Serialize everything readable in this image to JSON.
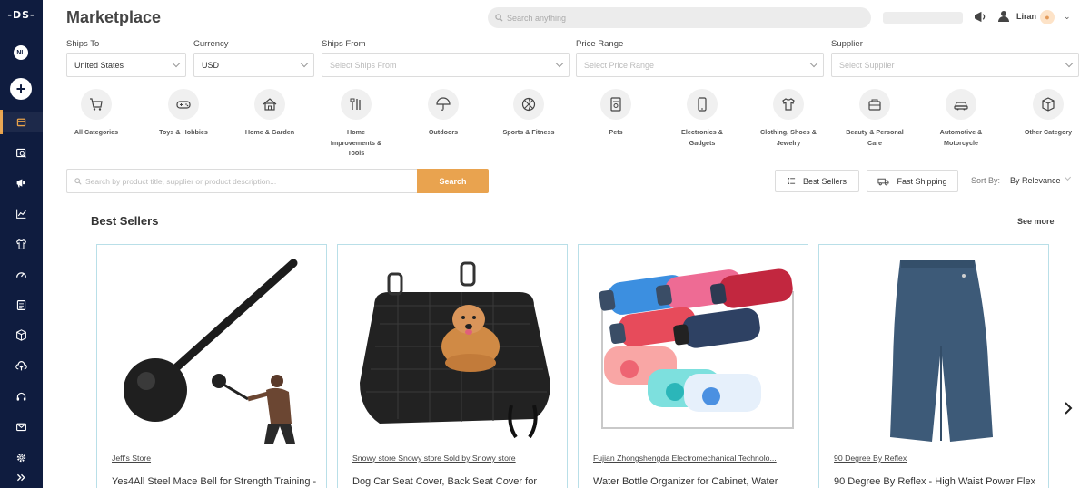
{
  "sidebar": {
    "logo": "-DS-",
    "avatar_initials": "NL",
    "add_label": "+",
    "items": [
      {
        "name": "marketplace",
        "icon": "store-icon"
      },
      {
        "name": "search-products",
        "icon": "product-search-icon"
      },
      {
        "name": "campaigns",
        "icon": "megaphone-icon"
      },
      {
        "name": "analytics",
        "icon": "chart-icon"
      },
      {
        "name": "apparel",
        "icon": "shirt-icon"
      },
      {
        "name": "dashboard",
        "icon": "gauge-icon"
      },
      {
        "name": "orders",
        "icon": "document-icon"
      },
      {
        "name": "products",
        "icon": "box-icon"
      },
      {
        "name": "upload",
        "icon": "cloud-upload-icon"
      },
      {
        "name": "support",
        "icon": "headset-icon"
      },
      {
        "name": "messages",
        "icon": "mail-icon"
      },
      {
        "name": "settings",
        "icon": "gear-icon"
      },
      {
        "name": "expand",
        "icon": "double-chevron-icon"
      }
    ]
  },
  "header": {
    "title": "Marketplace",
    "search_placeholder": "Search anything",
    "user_name": "Liran"
  },
  "filters": {
    "ships_to": {
      "label": "Ships To",
      "value": "United States"
    },
    "currency": {
      "label": "Currency",
      "value": "USD"
    },
    "ships_from": {
      "label": "Ships From",
      "placeholder": "Select Ships From"
    },
    "price_range": {
      "label": "Price Range",
      "placeholder": "Select Price Range"
    },
    "supplier": {
      "label": "Supplier",
      "placeholder": "Select Supplier"
    }
  },
  "categories": [
    {
      "label": "All Categories",
      "icon": "cart-icon"
    },
    {
      "label": "Toys & Hobbies",
      "icon": "gamepad-icon"
    },
    {
      "label": "Home & Garden",
      "icon": "house-icon"
    },
    {
      "label": "Home Improvements & Tools",
      "icon": "tools-icon"
    },
    {
      "label": "Outdoors",
      "icon": "umbrella-icon"
    },
    {
      "label": "Sports & Fitness",
      "icon": "ball-icon"
    },
    {
      "label": "Pets",
      "icon": "pet-food-icon"
    },
    {
      "label": "Electronics & Gadgets",
      "icon": "phone-icon"
    },
    {
      "label": "Clothing, Shoes & Jewelry",
      "icon": "shirt-icon"
    },
    {
      "label": "Beauty & Personal Care",
      "icon": "bag-icon"
    },
    {
      "label": "Automotive & Motorcycle",
      "icon": "car-icon"
    },
    {
      "label": "Other Category",
      "icon": "box-icon"
    }
  ],
  "product_search": {
    "placeholder": "Search by product title, supplier or product description...",
    "button_label": "Search"
  },
  "toolbar": {
    "best_sellers_label": "Best Sellers",
    "fast_shipping_label": "Fast Shipping",
    "sort_by_label": "Sort By:",
    "sort_value": "By Relevance"
  },
  "best_sellers": {
    "title": "Best Sellers",
    "see_more": "See more",
    "products": [
      {
        "store": "Jeff's Store",
        "title": "Yes4All Steel Mace Bell for Strength Training -",
        "image": "steel-mace-image"
      },
      {
        "store": "Snowy store Snowy store Sold by Snowy store",
        "title": "Dog Car Seat Cover, Back Seat Cover for",
        "image": "dog-seat-cover-image"
      },
      {
        "store": "Fujian Zhongshengda Electromechanical Technolo...",
        "title": "Water Bottle Organizer for Cabinet, Water",
        "image": "water-bottles-image"
      },
      {
        "store": "90 Degree By Reflex",
        "title": "90 Degree By Reflex - High Waist Power Flex",
        "image": "shorts-image"
      }
    ]
  },
  "colors": {
    "sidebar_bg": "#0f1c3f",
    "accent": "#e9a34f",
    "card_border": "#b9dfe8"
  }
}
